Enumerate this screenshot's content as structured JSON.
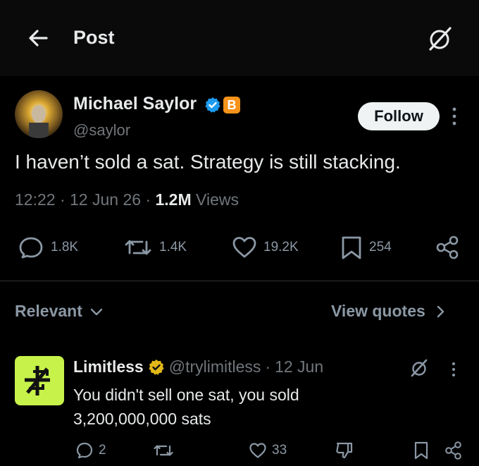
{
  "header": {
    "title": "Post"
  },
  "post": {
    "author_name": "Michael Saylor",
    "author_handle": "@saylor",
    "badge_letter": "B",
    "follow_label": "Follow",
    "text": "I haven’t sold a sat. Strategy is still stacking.",
    "time": "12:22",
    "date": "12 Jun 26",
    "views_count": "1.2M",
    "views_label": "Views",
    "replies": "1.8K",
    "reposts": "1.4K",
    "likes": "19.2K",
    "bookmarks": "254"
  },
  "replies_bar": {
    "sort_label": "Relevant",
    "view_quotes_label": "View quotes"
  },
  "reply": {
    "name": "Limitless",
    "handle": "@trylimitless",
    "date": "12 Jun",
    "text": "You didn't sell one sat, you sold 3,200,000,000 sats",
    "replies": "2",
    "likes": "33"
  },
  "colors": {
    "background": "#000000",
    "text": "#e7e9ea",
    "muted": "#71767b",
    "verified_blue": "#1d9bf0",
    "verified_gold": "#e2b719",
    "bitcoin_orange": "#f7931a",
    "limitless_green": "#c6f24a"
  },
  "icons": [
    "back-arrow-icon",
    "grok-icon",
    "verified-icon",
    "bitcoin-icon",
    "more-icon",
    "reply-icon",
    "repost-icon",
    "like-icon",
    "bookmark-icon",
    "share-icon",
    "chevron-down-icon",
    "chevron-right-icon",
    "dislike-icon"
  ]
}
